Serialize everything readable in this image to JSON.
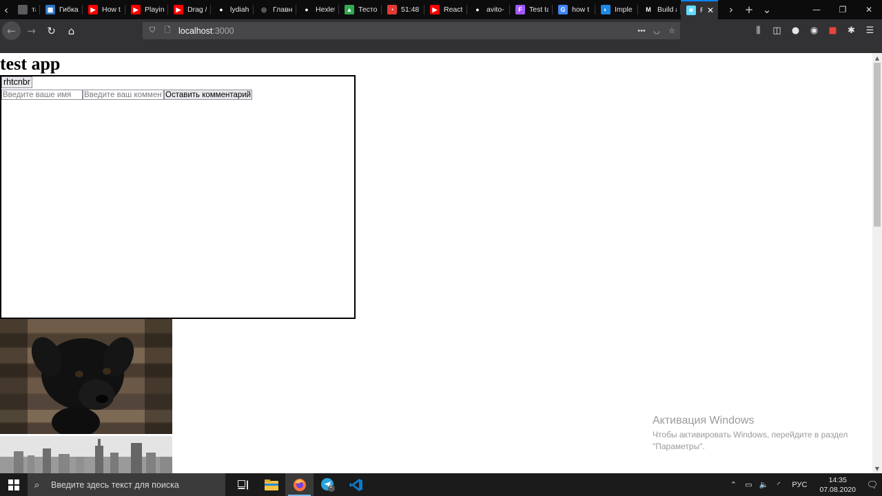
{
  "browser": {
    "tabs": [
      {
        "title": "та",
        "favicon": "generic-tab-icon",
        "color": "#5b5b60"
      },
      {
        "title": "Гибка",
        "favicon": "flexbox-icon",
        "color": "#2b74c4"
      },
      {
        "title": "How t",
        "favicon": "youtube-icon",
        "color": "#ff0000"
      },
      {
        "title": "Playin",
        "favicon": "youtube-icon",
        "color": "#ff0000"
      },
      {
        "title": "Drag /",
        "favicon": "youtube-icon",
        "color": "#ff0000"
      },
      {
        "title": "lydiah",
        "favicon": "github-icon",
        "color": "#ffffff"
      },
      {
        "title": "Главн",
        "favicon": "globe-icon",
        "color": "#9a9a9a"
      },
      {
        "title": "Hexlet",
        "favicon": "github-icon",
        "color": "#ffffff"
      },
      {
        "title": "Тесто",
        "favicon": "google-drive-icon",
        "color": "#34a853"
      },
      {
        "title": "51:48 |",
        "favicon": "timer-icon",
        "color": "#e53935"
      },
      {
        "title": "React",
        "favicon": "youtube-icon",
        "color": "#ff0000"
      },
      {
        "title": "avito-",
        "favicon": "github-icon",
        "color": "#ffffff"
      },
      {
        "title": "Test ta",
        "favicon": "figma-icon",
        "color": "#a259ff"
      },
      {
        "title": "how t",
        "favicon": "google-icon",
        "color": "#4285f4"
      },
      {
        "title": "Imple",
        "favicon": "spinner-icon",
        "color": "#1e88e5"
      },
      {
        "title": "Build a",
        "favicon": "medium-icon",
        "color": "#ffffff"
      },
      {
        "title": "Re",
        "favicon": "react-icon",
        "color": "#61dafb",
        "active": true
      }
    ],
    "url_host": "localhost",
    "url_port": ":3000"
  },
  "page": {
    "heading": "test app",
    "comment_item": "rhtcnbr",
    "name_placeholder": "Введите ваше имя",
    "comment_placeholder": "Введите ваш комментарий",
    "submit_label": "Оставить комментарий"
  },
  "watermark": {
    "title": "Активация Windows",
    "subtitle": "Чтобы активировать Windows, перейдите в раздел \"Параметры\"."
  },
  "taskbar": {
    "search_placeholder": "Введите здесь текст для поиска",
    "language": "РУС",
    "time": "14:35",
    "date": "07.08.2020",
    "telegram_badge": "1"
  }
}
